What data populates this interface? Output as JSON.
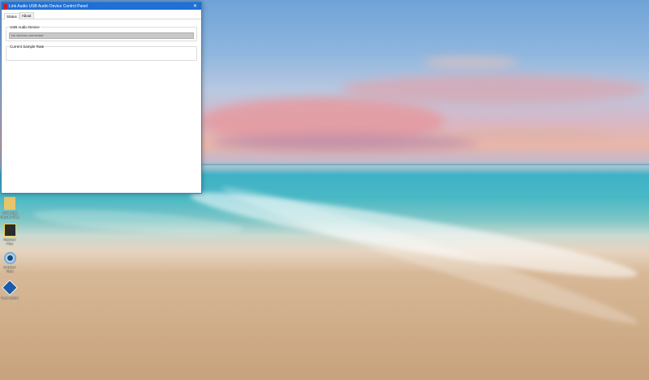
{
  "window": {
    "title": "Link Audio USB Audio Device Control Panel",
    "close_glyph": "✕",
    "tabs": [
      {
        "label": "Status",
        "active": true
      },
      {
        "label": "About",
        "active": false
      }
    ],
    "groups": {
      "usb_device": {
        "label": "USB Audio Device",
        "field_value": "No devices connected"
      },
      "sample_rate": {
        "label": "Current Sample Rate"
      }
    }
  },
  "desktop": {
    "icons": [
      {
        "name": "folder-icon",
        "label": "Some App Reports Files"
      },
      {
        "name": "app-shortcut-icon",
        "label": "Recover Files"
      },
      {
        "name": "disc-tool-icon",
        "label": "Explorer Tools"
      },
      {
        "name": "diamond-app-icon",
        "label": "Tools Studio"
      }
    ]
  },
  "colors": {
    "titlebar": "#1f6fd6",
    "window_border": "#3c7fd1"
  }
}
